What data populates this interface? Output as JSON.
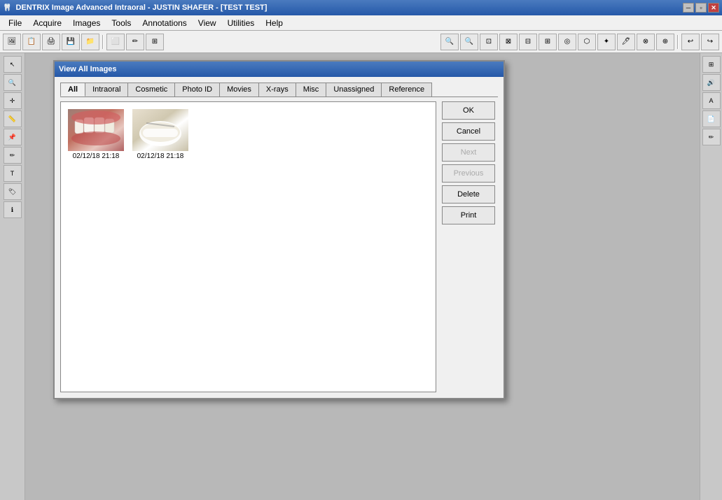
{
  "titleBar": {
    "text": "DENTRIX Image Advanced Intraoral - JUSTIN SHAFER - [TEST TEST]",
    "controls": [
      "minimize",
      "restore",
      "close"
    ]
  },
  "menuBar": {
    "items": [
      "File",
      "Acquire",
      "Images",
      "Tools",
      "Annotations",
      "View",
      "Utilities",
      "Help"
    ]
  },
  "dialog": {
    "title": "View All Images",
    "tabs": [
      "All",
      "Intraoral",
      "Cosmetic",
      "Photo ID",
      "Movies",
      "X-rays",
      "Misc",
      "Unassigned",
      "Reference"
    ],
    "activeTab": "All",
    "images": [
      {
        "label": "02/12/18 21:18",
        "type": "tooth1"
      },
      {
        "label": "02/12/18 21:18",
        "type": "tooth2"
      }
    ],
    "buttons": {
      "ok": "OK",
      "cancel": "Cancel",
      "next": "Next",
      "previous": "Previous",
      "delete": "Delete",
      "print": "Print"
    }
  },
  "leftSidebar": {
    "buttons": [
      "cursor",
      "zoom",
      "cross",
      "measure",
      "annotate",
      "draw",
      "text",
      "tag",
      "info"
    ]
  }
}
